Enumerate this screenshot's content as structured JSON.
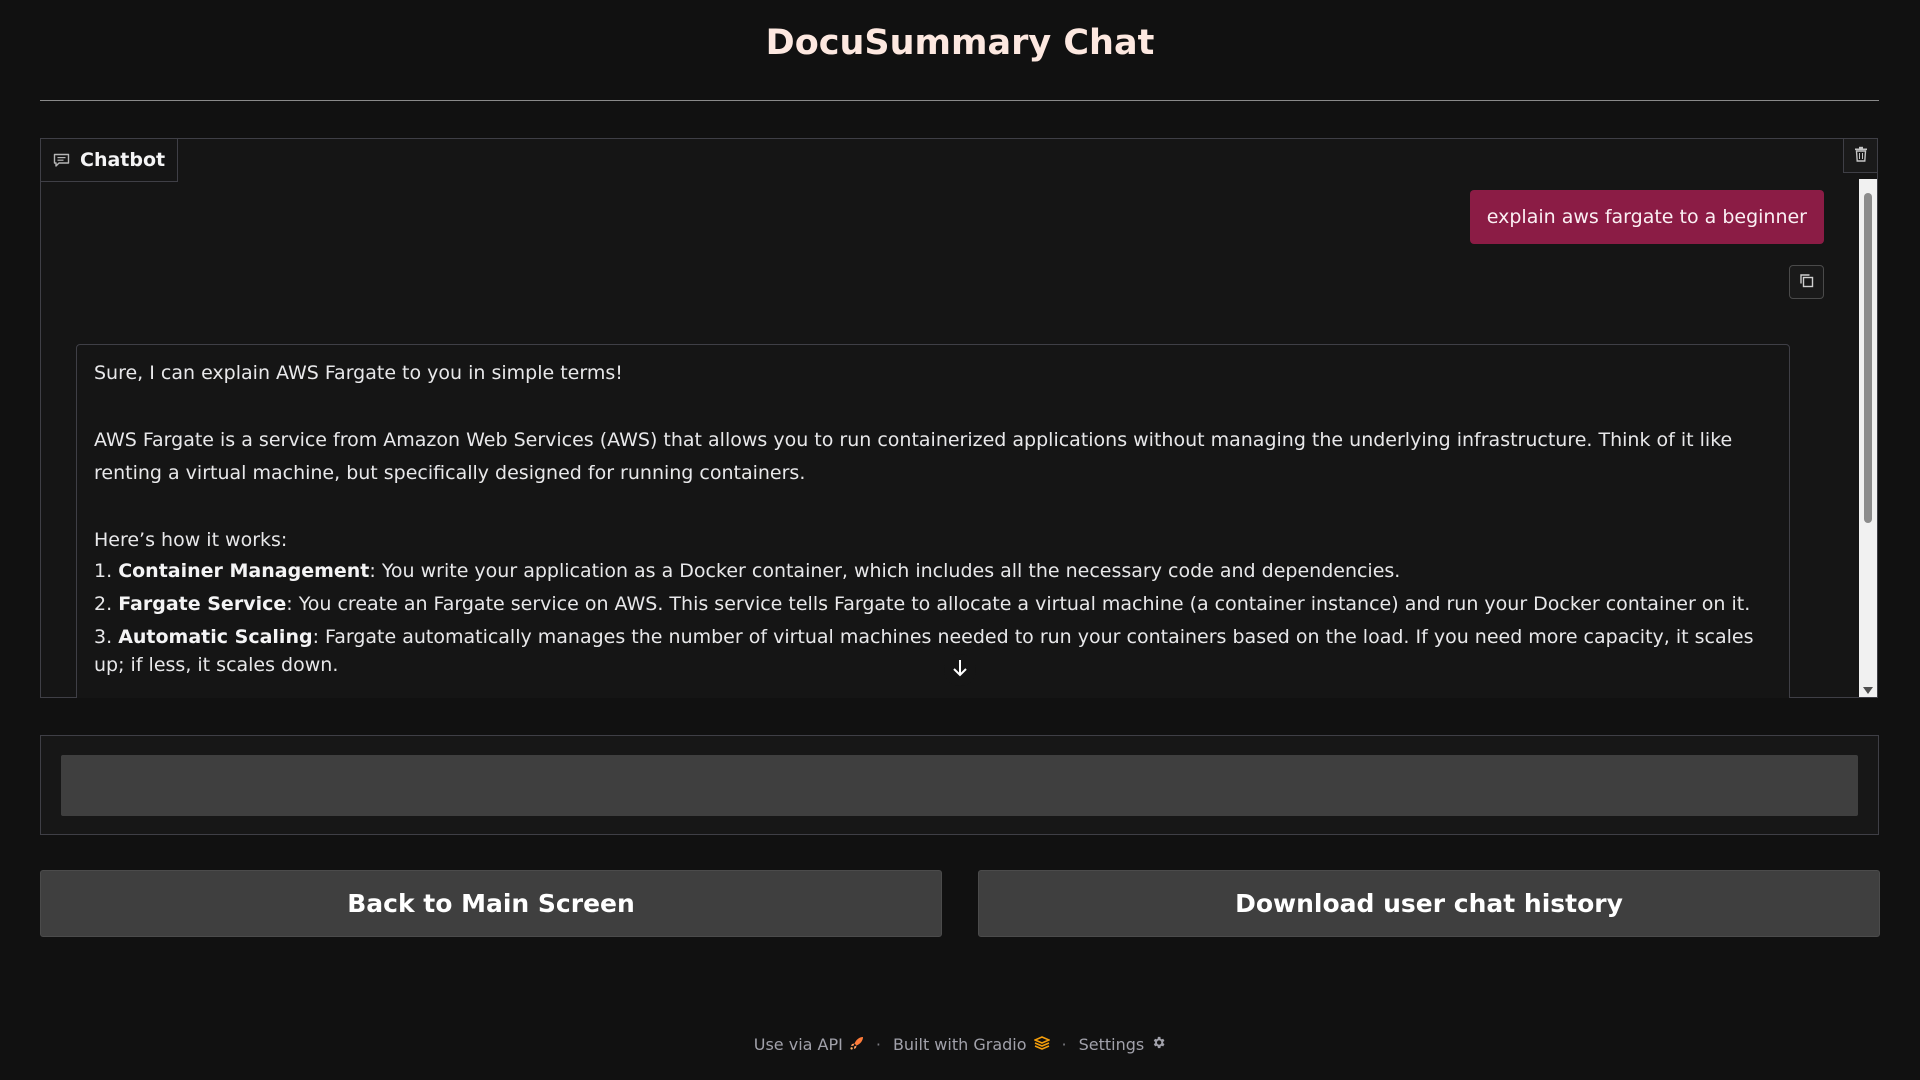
{
  "app": {
    "title": "DocuSummary Chat"
  },
  "chatbot": {
    "label": "Chatbot",
    "icons": {
      "label": "chat-bubble-icon",
      "clear": "trash-icon",
      "copy": "copy-icon",
      "scroll": "arrow-down-icon"
    },
    "user_message": "explain aws fargate to a beginner",
    "bot_message": {
      "intro": "Sure, I can explain AWS Fargate to you in simple terms!",
      "paragraph": "AWS Fargate is a service from Amazon Web Services (AWS) that allows you to run containerized applications without managing the underlying infrastructure. Think of it like renting a virtual machine, but specifically designed for running containers.",
      "how_it_works": "Here’s how it works:",
      "steps": [
        {
          "num": "1.",
          "title": "Container Management",
          "text": ": You write your application as a Docker container, which includes all the necessary code and dependencies."
        },
        {
          "num": "2.",
          "title": "Fargate Service",
          "text": ": You create an Fargate service on AWS. This service tells Fargate to allocate a virtual machine (a container instance) and run your Docker container on it."
        },
        {
          "num": "3.",
          "title": "Automatic Scaling",
          "text": ": Fargate automatically manages the number of virtual machines needed to run your containers based on the load. If you need more capacity, it scales up; if less, it scales down."
        }
      ]
    }
  },
  "input": {
    "value": "",
    "placeholder": ""
  },
  "buttons": {
    "back": "Back to Main Screen",
    "download": "Download user chat history"
  },
  "footer": {
    "api": "Use via API",
    "built": "Built with Gradio",
    "settings": "Settings",
    "separator": "·",
    "icons": {
      "api": "rocket-icon",
      "built": "gradio-logo-icon",
      "settings": "gear-icon"
    }
  },
  "colors": {
    "background": "#111111",
    "user_bubble": "#8b1c45",
    "button": "#3f3f3f",
    "title": "#fde8e0"
  }
}
